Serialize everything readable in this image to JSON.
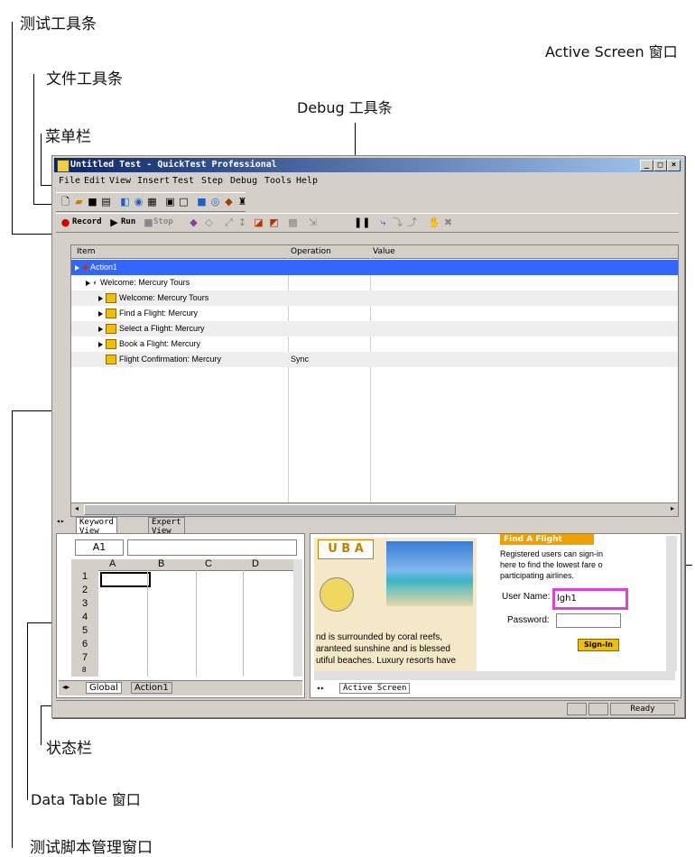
{
  "annotations": {
    "test_toolbar": "测试工具条",
    "file_toolbar": "文件工具条",
    "debug_toolbar": "Debug 工具条",
    "menubar": "菜单栏",
    "active_screen_window": "Active Screen 窗口",
    "status_bar": "状态栏",
    "data_table_window": "Data Table 窗口",
    "test_script_window": "测试脚本管理窗口"
  },
  "window": {
    "title": "Untitled Test - QuickTest Professional",
    "menu": [
      "File",
      "Edit",
      "View",
      "Insert",
      "Test",
      "Step",
      "Debug",
      "Tools",
      "Help"
    ],
    "test_toolbar": {
      "record": "Record",
      "run": "Run",
      "stop": "Stop"
    }
  },
  "keyword_view": {
    "columns": [
      "Item",
      "Operation",
      "Value"
    ],
    "rows": [
      {
        "label": "Action1",
        "op": ""
      },
      {
        "label": "Welcome: Mercury Tours",
        "op": ""
      },
      {
        "label": "Welcome: Mercury Tours",
        "op": ""
      },
      {
        "label": "Find a Flight: Mercury",
        "op": ""
      },
      {
        "label": "Select a Flight: Mercury",
        "op": ""
      },
      {
        "label": "Book a Flight: Mercury",
        "op": ""
      },
      {
        "label": "Flight Confirmation: Mercury",
        "op": "Sync"
      }
    ],
    "tabs": [
      "Keyword View",
      "Expert View"
    ]
  },
  "data_table": {
    "cell_ref": "A1",
    "columns": [
      "A",
      "B",
      "C",
      "D"
    ],
    "rows": [
      "1",
      "2",
      "3",
      "4",
      "5",
      "6",
      "7",
      "8"
    ],
    "tabs": [
      "Global",
      "Action1"
    ]
  },
  "active_screen": {
    "banner": "U B A",
    "body_text": [
      "nd is surrounded by coral reefs,",
      "aranteed sunshine and is blessed",
      "utiful beaches. Luxury resorts have"
    ],
    "find_flight": "Find A Flight",
    "info": [
      "Registered users can sign-in",
      "here to find the lowest fare o",
      "participating airlines."
    ],
    "username_label": "User Name:",
    "username_value": "lgh1",
    "password_label": "Password:",
    "signin": "Sign-In",
    "tab": "Active Screen"
  },
  "status": {
    "text": "Ready"
  }
}
